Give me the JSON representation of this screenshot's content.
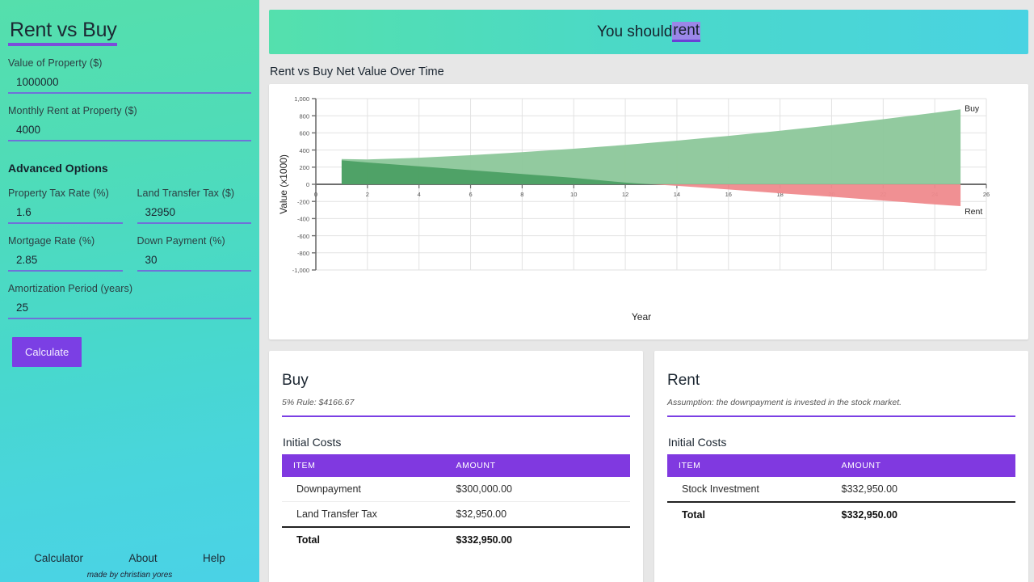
{
  "sidebar": {
    "title": "Rent vs Buy",
    "fields": [
      {
        "label": "Value of Property ($)",
        "value": "1000000",
        "name": "property-value"
      },
      {
        "label": "Monthly Rent at Property ($)",
        "value": "4000",
        "name": "monthly-rent"
      }
    ],
    "advanced_title": "Advanced Options",
    "advanced_fields": [
      {
        "label": "Property Tax Rate (%)",
        "value": "1.6",
        "name": "property-tax-rate"
      },
      {
        "label": "Land Transfer Tax ($)",
        "value": "32950",
        "name": "land-transfer-tax"
      },
      {
        "label": "Mortgage Rate (%)",
        "value": "2.85",
        "name": "mortgage-rate"
      },
      {
        "label": "Down Payment (%)",
        "value": "30",
        "name": "down-payment"
      },
      {
        "label": "Amortization Period (years)",
        "value": "25",
        "name": "amortization-period"
      }
    ],
    "calculate_label": "Calculate",
    "nav": [
      "Calculator",
      "About",
      "Help"
    ],
    "credit": "made by christian yores",
    "accent": "#7b3fe4"
  },
  "banner": {
    "prefix": "You should ",
    "highlight": "rent"
  },
  "chart_section": {
    "title": "Rent vs Buy Net Value Over Time"
  },
  "chart_data": {
    "type": "area",
    "title": "Rent vs Buy Net Value Over Time",
    "xlabel": "Year",
    "ylabel": "Value (x1000)",
    "xlim": [
      0,
      26
    ],
    "ylim": [
      -1000,
      1000
    ],
    "xticks": [
      0,
      2,
      4,
      6,
      8,
      10,
      12,
      14,
      16,
      18,
      20,
      22,
      24,
      26
    ],
    "yticks": [
      -1000,
      -800,
      -600,
      -400,
      -200,
      0,
      200,
      400,
      600,
      800,
      1000
    ],
    "grid": true,
    "legend_position": "right-inline",
    "series": [
      {
        "name": "Buy",
        "color": "#8cc79a",
        "x": [
          1,
          2,
          4,
          6,
          8,
          10,
          12,
          14,
          16,
          18,
          20,
          22,
          24,
          25
        ],
        "values": [
          295,
          290,
          310,
          340,
          375,
          415,
          460,
          510,
          565,
          625,
          690,
          760,
          835,
          875
        ]
      },
      {
        "name": "Rent",
        "color": "#ef8a8d",
        "x": [
          1,
          2,
          4,
          6,
          8,
          10,
          12,
          13,
          14,
          16,
          18,
          20,
          22,
          24,
          25
        ],
        "values": [
          280,
          255,
          210,
          165,
          120,
          75,
          20,
          0,
          -18,
          -60,
          -105,
          -145,
          -190,
          -235,
          -255
        ]
      }
    ],
    "annotations": [
      {
        "text": "Buy",
        "x": 25,
        "y": 875
      },
      {
        "text": "Rent",
        "x": 25,
        "y": -255
      }
    ]
  },
  "buy_card": {
    "heading": "Buy",
    "subtitle": "5% Rule: $4166.67",
    "table_title": "Initial Costs",
    "columns": [
      "ITEM",
      "AMOUNT"
    ],
    "rows": [
      {
        "item": "Downpayment",
        "amount": "$300,000.00"
      },
      {
        "item": "Land Transfer Tax",
        "amount": "$32,950.00"
      }
    ],
    "total_label": "Total",
    "total_amount": "$332,950.00"
  },
  "rent_card": {
    "heading": "Rent",
    "subtitle": "Assumption: the downpayment is invested in the stock market.",
    "table_title": "Initial Costs",
    "columns": [
      "ITEM",
      "AMOUNT"
    ],
    "rows": [
      {
        "item": "Stock Investment",
        "amount": "$332,950.00"
      }
    ],
    "total_label": "Total",
    "total_amount": "$332,950.00"
  }
}
